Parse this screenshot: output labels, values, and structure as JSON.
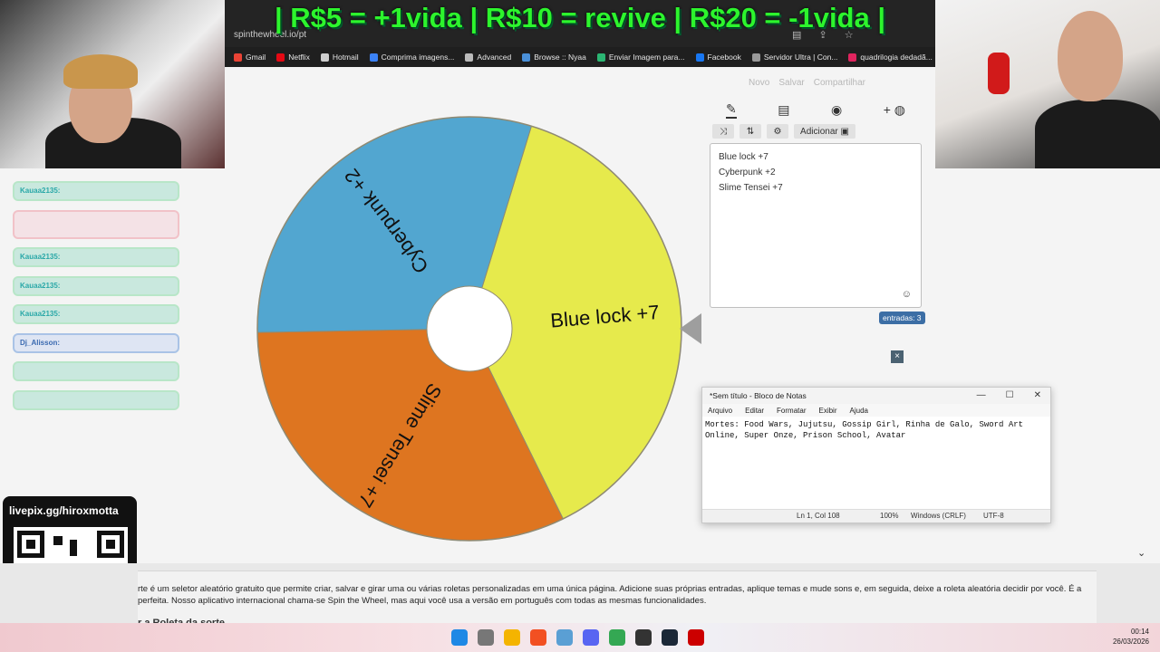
{
  "browser": {
    "address": "spinthewheel.io/pt",
    "bookmarks": [
      {
        "label": "Gmail",
        "color": "#ea4335"
      },
      {
        "label": "Netflix",
        "color": "#e50914"
      },
      {
        "label": "Hotmail",
        "color": "#cfcfcf"
      },
      {
        "label": "Comprima imagens...",
        "color": "#3b82f6"
      },
      {
        "label": "Advanced",
        "color": "#bbbbbb"
      },
      {
        "label": "Browse :: Nyaa",
        "color": "#4a90d9"
      },
      {
        "label": "Enviar Imagem para...",
        "color": "#2bb673"
      },
      {
        "label": "Facebook",
        "color": "#1877f2"
      },
      {
        "label": "Servidor Ultra | Con...",
        "color": "#999999"
      },
      {
        "label": "quadrilogia dedadã...",
        "color": "#e0245e"
      }
    ]
  },
  "stream_banner": "| R$5 = +1vida | R$10 = revive | R$20 = -1vida |",
  "chat": [
    {
      "user": "Kauaa2135:",
      "text": "",
      "style": "teal"
    },
    {
      "user": "",
      "text": "",
      "style": "pink"
    },
    {
      "user": "Kauaa2135:",
      "text": "",
      "style": "teal"
    },
    {
      "user": "Kauaa2135:",
      "text": "",
      "style": "teal"
    },
    {
      "user": "Kauaa2135:",
      "text": "",
      "style": "teal"
    },
    {
      "user": "Dj_Alisson:",
      "text": "",
      "style": "blue"
    },
    {
      "user": "",
      "text": "",
      "style": "green"
    },
    {
      "user": "",
      "text": "",
      "style": "green"
    }
  ],
  "livepix": {
    "text": "livepix.gg/hiroxmotta"
  },
  "page_actions": [
    "Novo",
    "Salvar",
    "Compartilhar"
  ],
  "wheel": {
    "segments": [
      {
        "label": "Blue lock +7",
        "color": "#e6ea4c",
        "share": 0.38
      },
      {
        "label": "Slime Tensei +7",
        "color": "#de7520",
        "share": 0.32
      },
      {
        "label": "Cyberpunk +2",
        "color": "#52a6d0",
        "share": 0.3
      }
    ],
    "border_color": "#8f8a73"
  },
  "editor": {
    "add_button": "Adicionar",
    "entries": [
      "Blue lock +7",
      "Cyberpunk +2",
      "Slime Tensei +7"
    ],
    "count_label": "entradas: 3",
    "close_label": "×"
  },
  "notepad": {
    "title": "*Sem título - Bloco de Notas",
    "menu": [
      "Arquivo",
      "Editar",
      "Formatar",
      "Exibir",
      "Ajuda"
    ],
    "line1": "Mortes: Food Wars, Jujutsu, Gossip Girl, Rinha de Galo, Sword Art",
    "line2": "Online, Super Onze, Prison School, Avatar",
    "status": {
      "position": "Ln 1, Col 108",
      "zoom": "100%",
      "eol": "Windows (CRLF)",
      "encoding": "UTF-8"
    }
  },
  "description": {
    "line1": "rte é um seletor aleatório gratuito que permite criar, salvar e girar uma ou várias roletas personalizadas em uma única página. Adicione suas próprias entradas, aplique temas e mude sons e, em seguida, deixe a roleta aleatória decidir por você. É a",
    "line2": "perfeita. Nosso aplicativo internacional chama-se Spin the Wheel, mas aqui você usa a versão em português com todas as mesmas funcionalidades.",
    "subtitle": "r a Roleta da sorte"
  },
  "taskbar": {
    "time": "00:14",
    "date": "26/03/2026",
    "icon_colors": [
      "#1e88e5",
      "#777777",
      "#f4b400",
      "#f25022",
      "#5a9fd4",
      "#5865f2",
      "#34a853",
      "#333333",
      "#1b2838",
      "#cc0000"
    ]
  }
}
